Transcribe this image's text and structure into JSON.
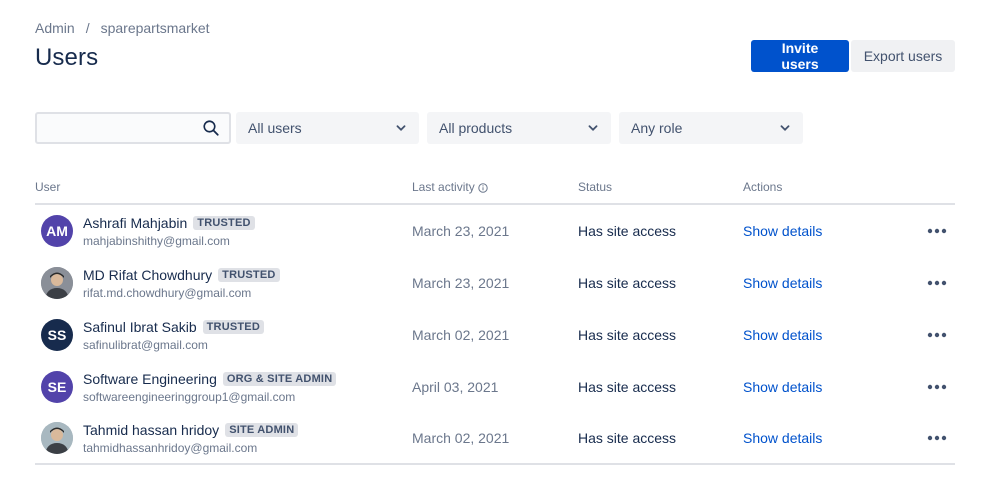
{
  "breadcrumb": {
    "root": "Admin",
    "separator": "/",
    "site": "sparepartsmarket"
  },
  "page": {
    "title": "Users"
  },
  "actions": {
    "invite": "Invite users",
    "export": "Export users"
  },
  "filters": {
    "search_value": "",
    "users": "All users",
    "products": "All products",
    "role": "Any role"
  },
  "table": {
    "headers": {
      "user": "User",
      "last_activity": "Last activity",
      "status": "Status",
      "actions": "Actions"
    },
    "rows": [
      {
        "initials": "AM",
        "avatar_color": "#5243aa",
        "avatar_type": "initials",
        "name": "Ashrafi Mahjabin",
        "badge": "TRUSTED",
        "email": "mahjabinshithy@gmail.com",
        "last_activity": "March 23, 2021",
        "status": "Has site access",
        "action": "Show details"
      },
      {
        "initials": "",
        "avatar_color": "#8a8f98",
        "avatar_type": "photo",
        "name": "MD Rifat Chowdhury",
        "badge": "TRUSTED",
        "email": "rifat.md.chowdhury@gmail.com",
        "last_activity": "March 23, 2021",
        "status": "Has site access",
        "action": "Show details"
      },
      {
        "initials": "SS",
        "avatar_color": "#172b4d",
        "avatar_type": "initials",
        "name": "Safinul Ibrat Sakib",
        "badge": "TRUSTED",
        "email": "safinulibrat@gmail.com",
        "last_activity": "March 02, 2021",
        "status": "Has site access",
        "action": "Show details"
      },
      {
        "initials": "SE",
        "avatar_color": "#5243aa",
        "avatar_type": "initials",
        "name": "Software Engineering",
        "badge": "ORG & SITE ADMIN",
        "email": "softwareengineeringgroup1@gmail.com",
        "last_activity": "April 03, 2021",
        "status": "Has site access",
        "action": "Show details"
      },
      {
        "initials": "",
        "avatar_color": "#a8b8c0",
        "avatar_type": "photo",
        "name": "Tahmid hassan hridoy",
        "badge": "SITE ADMIN",
        "email": "tahmidhassanhridoy@gmail.com",
        "last_activity": "March 02, 2021",
        "status": "Has site access",
        "action": "Show details"
      }
    ]
  },
  "colors": {
    "primary": "#0052cc",
    "text": "#172b4d",
    "subtle": "#6b778c",
    "link": "#0052cc"
  }
}
